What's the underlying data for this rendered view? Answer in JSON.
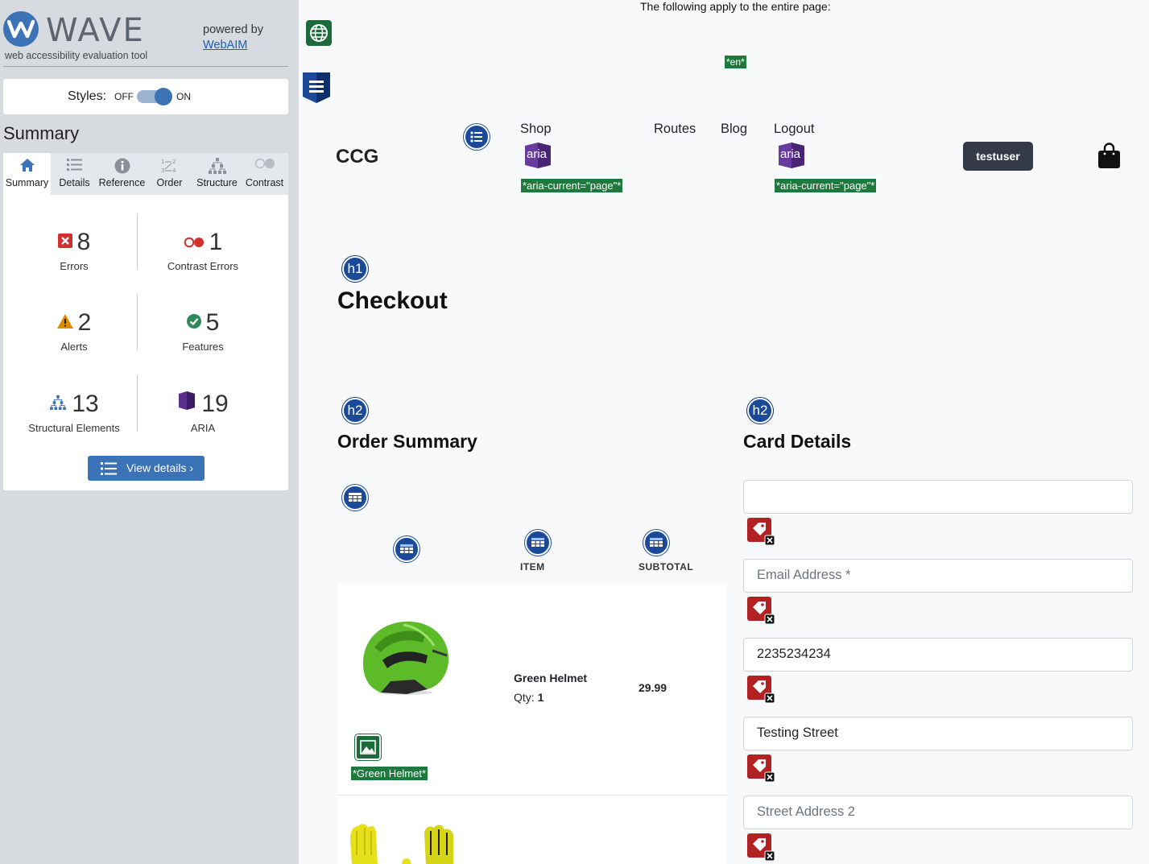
{
  "wave": {
    "logo_text": "WAVE",
    "tagline": "web accessibility evaluation tool",
    "powered_by": "powered by",
    "webaim_link": "WebAIM",
    "styles_label": "Styles:",
    "styles_off": "OFF",
    "styles_on": "ON",
    "summary_heading": "Summary",
    "tabs": [
      {
        "label": "Summary",
        "icon": "home-icon"
      },
      {
        "label": "Details",
        "icon": "list-icon"
      },
      {
        "label": "Reference",
        "icon": "info-icon"
      },
      {
        "label": "Order",
        "icon": "order-icon"
      },
      {
        "label": "Structure",
        "icon": "structure-icon"
      },
      {
        "label": "Contrast",
        "icon": "contrast-icon"
      }
    ],
    "stats": {
      "errors": {
        "count": "8",
        "label": "Errors"
      },
      "contrast_errors": {
        "count": "1",
        "label": "Contrast Errors"
      },
      "alerts": {
        "count": "2",
        "label": "Alerts"
      },
      "features": {
        "count": "5",
        "label": "Features"
      },
      "structural": {
        "count": "13",
        "label": "Structural Elements"
      },
      "aria": {
        "count": "19",
        "label": "ARIA"
      }
    },
    "view_details": "View details ›",
    "colors": {
      "brand": "#3c72b6",
      "error": "#d0312d",
      "alert": "#e08a00",
      "feature": "#2e8b57",
      "aria": "#5b2d8e"
    }
  },
  "page": {
    "apply_note": "The following apply to the entire page:",
    "lang_label": "*en*",
    "brand": "CCG",
    "nav": {
      "shop": "Shop",
      "routes": "Routes",
      "blog": "Blog",
      "logout": "Logout",
      "aria_text": "aria",
      "aria_current_label": "*aria-current=\"page\"*"
    },
    "user_button": "testuser",
    "h1_badge": "h1",
    "h2_badge": "h2",
    "title": "Checkout",
    "order_summary_heading": "Order Summary",
    "card_details_heading": "Card Details",
    "table": {
      "col_item": "ITEM",
      "col_subtotal": "SUBTOTAL",
      "rows": [
        {
          "name": "Green Helmet",
          "qty_label": "Qty:",
          "qty": "1",
          "subtotal": "29.99",
          "alt_label": "*Green Helmet*"
        }
      ]
    },
    "form": {
      "field1_value": "",
      "email_placeholder": "Email Address *",
      "phone_value": "2235234234",
      "street_value": "Testing Street",
      "street2_placeholder": "Street Address 2"
    }
  }
}
